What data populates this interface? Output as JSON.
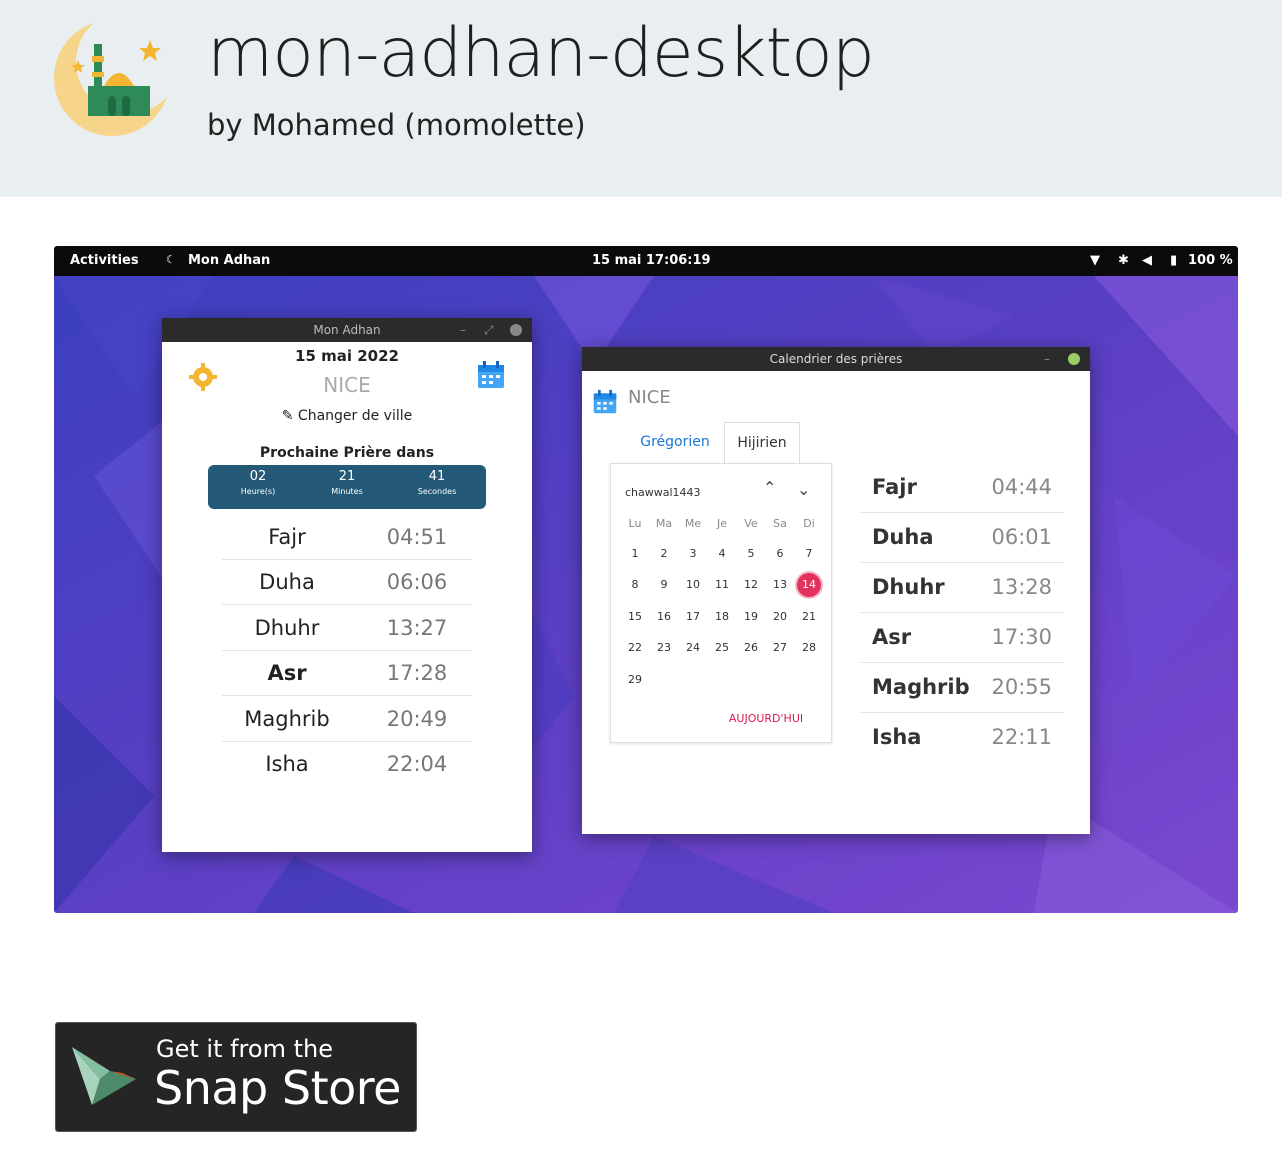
{
  "header": {
    "app_name": "mon-adhan-desktop",
    "publisher": "by Mohamed (momolette)"
  },
  "screenshot": {
    "topbar": {
      "activities": "Activities",
      "app_menu": "Mon Adhan",
      "clock": "15 mai  17:06:19",
      "battery": "100 %"
    },
    "main_window": {
      "title": "Mon Adhan",
      "date": "15 mai 2022",
      "city": "NICE",
      "change_city": "Changer de ville",
      "next_prayer_label": "Prochaine Prière dans",
      "countdown": [
        {
          "value": "02",
          "label": "Heure(s)"
        },
        {
          "value": "21",
          "label": "Minutes"
        },
        {
          "value": "41",
          "label": "Secondes"
        }
      ],
      "prayers": [
        {
          "name": "Fajr",
          "time": "04:51"
        },
        {
          "name": "Duha",
          "time": "06:06"
        },
        {
          "name": "Dhuhr",
          "time": "13:27"
        },
        {
          "name": "Asr",
          "time": "17:28"
        },
        {
          "name": "Maghrib",
          "time": "20:49"
        },
        {
          "name": "Isha",
          "time": "22:04"
        }
      ]
    },
    "calendar_window": {
      "title": "Calendrier des prières",
      "city": "NICE",
      "tabs": [
        "Grégorien",
        "Hijirien"
      ],
      "month_label": "chawwal1443",
      "weekdays": [
        "Lu",
        "Ma",
        "Me",
        "Je",
        "Ve",
        "Sa",
        "Di"
      ],
      "days": [
        [
          "1",
          "2",
          "3",
          "4",
          "5",
          "6",
          "7"
        ],
        [
          "8",
          "9",
          "10",
          "11",
          "12",
          "13",
          "14"
        ],
        [
          "15",
          "16",
          "17",
          "18",
          "19",
          "20",
          "21"
        ],
        [
          "22",
          "23",
          "24",
          "25",
          "26",
          "27",
          "28"
        ],
        [
          "29"
        ]
      ],
      "selected_day": "14",
      "today_button": "AUJOURD'HUI",
      "prayers": [
        {
          "name": "Fajr",
          "time": "04:44"
        },
        {
          "name": "Duha",
          "time": "06:01"
        },
        {
          "name": "Dhuhr",
          "time": "13:28"
        },
        {
          "name": "Asr",
          "time": "17:30"
        },
        {
          "name": "Maghrib",
          "time": "20:55"
        },
        {
          "name": "Isha",
          "time": "22:11"
        }
      ]
    }
  },
  "snap_badge": {
    "line1": "Get it from the",
    "line2": "Snap Store"
  },
  "colors": {
    "header_bg": "#e9eff0",
    "countdown_bg": "#245a78",
    "calendar_accent": "#e2315a",
    "tab_active_text": "#1976d2",
    "desktop_bg": "#5b3fc4"
  }
}
